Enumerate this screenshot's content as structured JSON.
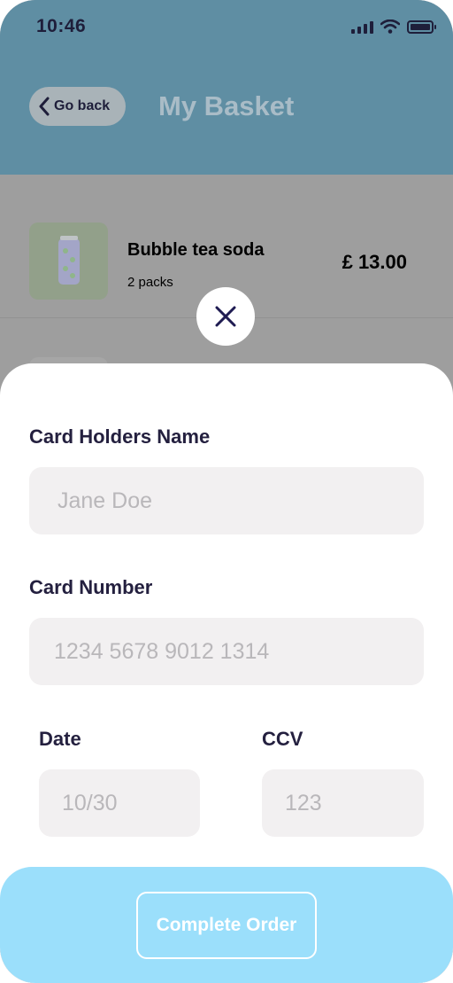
{
  "status_bar": {
    "time": "10:46"
  },
  "header": {
    "back_label": "Go back",
    "title": "My Basket"
  },
  "basket": {
    "items": [
      {
        "name": "Bubble tea soda",
        "quantity": "2 packs",
        "price": "£ 13.00"
      }
    ]
  },
  "payment_form": {
    "name_label": "Card Holders Name",
    "name_placeholder": "Jane Doe",
    "number_label": "Card Number",
    "number_placeholder": "1234 5678 9012 1314",
    "date_label": "Date",
    "date_placeholder": "10/30",
    "ccv_label": "CCV",
    "ccv_placeholder": "123",
    "submit_label": "Complete Order"
  },
  "colors": {
    "accent": "#9bdffb",
    "header": "#5f8ea3",
    "text_dark": "#24203f",
    "field_bg": "#f2f0f1"
  },
  "icons": [
    "back-chevron-icon",
    "close-icon",
    "cellular-signal-icon",
    "wifi-icon",
    "battery-icon",
    "soda-can-icon"
  ]
}
